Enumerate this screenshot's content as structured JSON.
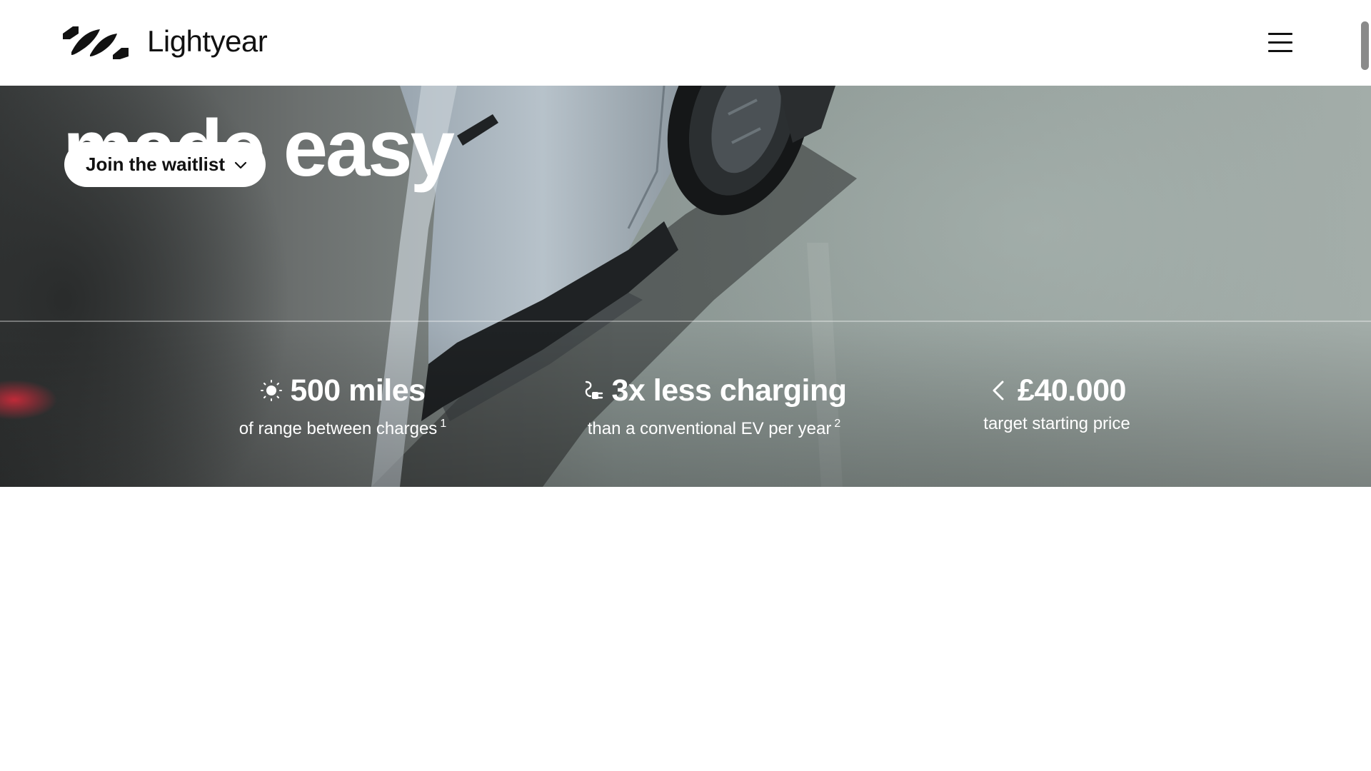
{
  "header": {
    "logo_icon": "lightyear-logo-mark",
    "logo_text": "Lightyear",
    "menu_icon": "hamburger-menu-icon"
  },
  "hero": {
    "title": "made easy",
    "waitlist_button": {
      "label": "Join the waitlist",
      "icon": "chevron-down-icon"
    }
  },
  "stats": [
    {
      "icon": "sun-icon",
      "value": "500 miles",
      "caption": "of range between charges",
      "footnote": "1"
    },
    {
      "icon": "plug-icon",
      "value": "3x less charging",
      "caption": "than a conventional EV per year",
      "footnote": "2"
    },
    {
      "icon": "chevron-left-icon",
      "value": "£40.000",
      "caption": "target starting price",
      "footnote": ""
    }
  ],
  "colors": {
    "text_dark": "#111111",
    "hero_text": "#ffffff",
    "page_bg": "#ffffff"
  }
}
